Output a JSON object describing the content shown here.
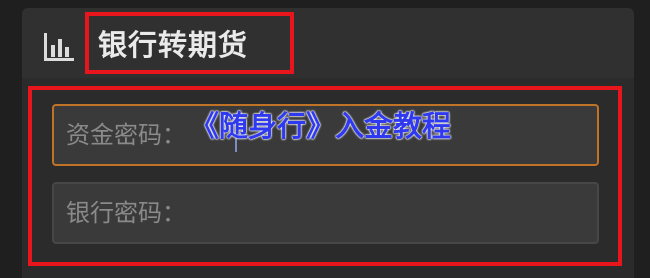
{
  "dialog": {
    "title": "银行转期货",
    "title_icon": "bar-chart-icon"
  },
  "form": {
    "fund_password_placeholder": "资金密码：",
    "bank_password_placeholder": "银行密码："
  },
  "overlay": {
    "caption": "《随身行》入金教程"
  },
  "colors": {
    "annotation_red": "#e8151d",
    "focus_border": "#c07226",
    "caption_blue": "#2f3af0"
  }
}
